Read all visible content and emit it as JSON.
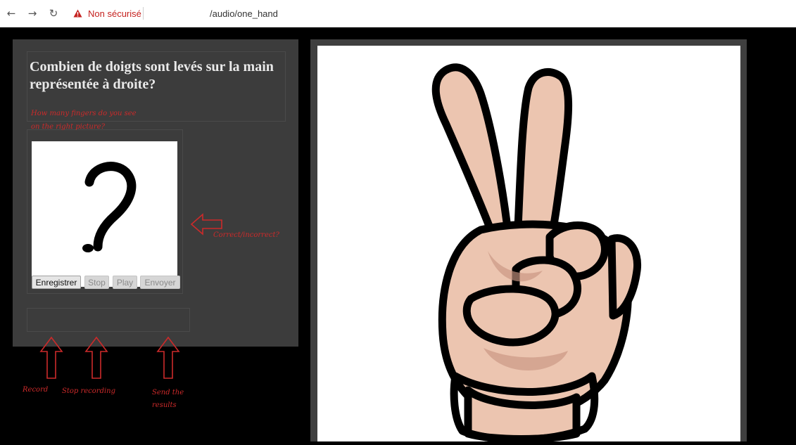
{
  "browser": {
    "security_label": "Non sécurisé",
    "url_path": "/audio/one_hand"
  },
  "question": {
    "title": "Combien de doigts sont levés sur la main représentée à droite?"
  },
  "buttons": {
    "record": "Enregistrer",
    "stop": "Stop",
    "play": "Play",
    "send": "Envoyer"
  },
  "annotations": {
    "question_line1": "How many fingers do you see",
    "question_line2": "on the right picture?",
    "correct": "Correct/incorrect?",
    "record": "Record",
    "stop": "Stop recording",
    "send_line1": "Send the",
    "send_line2": "results"
  },
  "colors": {
    "annotation": "#cc2a2a",
    "panel": "#3c3c3c",
    "warning": "#c5221f"
  },
  "icons": {
    "back": "back-arrow-icon",
    "forward": "forward-arrow-icon",
    "reload": "reload-icon",
    "warning": "warning-triangle-icon",
    "question_mark": "question-mark-image",
    "hand": "peace-sign-hand-image"
  }
}
